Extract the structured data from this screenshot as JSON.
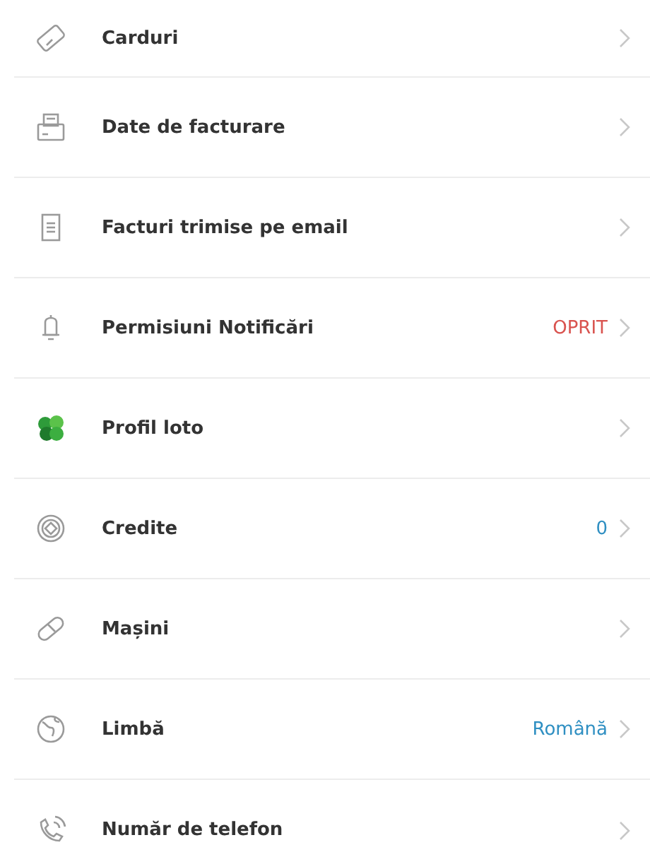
{
  "settings": [
    {
      "kind": "card",
      "label": "Carduri"
    },
    {
      "kind": "printer",
      "label": "Date de facturare"
    },
    {
      "kind": "receipt",
      "label": "Facturi trimise pe email"
    },
    {
      "kind": "bell",
      "label": "Permisiuni Notificări",
      "value": {
        "text": "OPRIT",
        "color": "#d9534f"
      }
    },
    {
      "kind": "clover",
      "label": "Profil loto"
    },
    {
      "kind": "coin",
      "label": "Credite",
      "value": {
        "text": "0",
        "color": "#2f8fc2"
      }
    },
    {
      "kind": "bandage",
      "label": "Mașini"
    },
    {
      "kind": "globe",
      "label": "Limbă",
      "value": {
        "text": "Română",
        "color": "#2f8fc2"
      }
    },
    {
      "kind": "phone",
      "label": "Număr de telefon"
    }
  ]
}
